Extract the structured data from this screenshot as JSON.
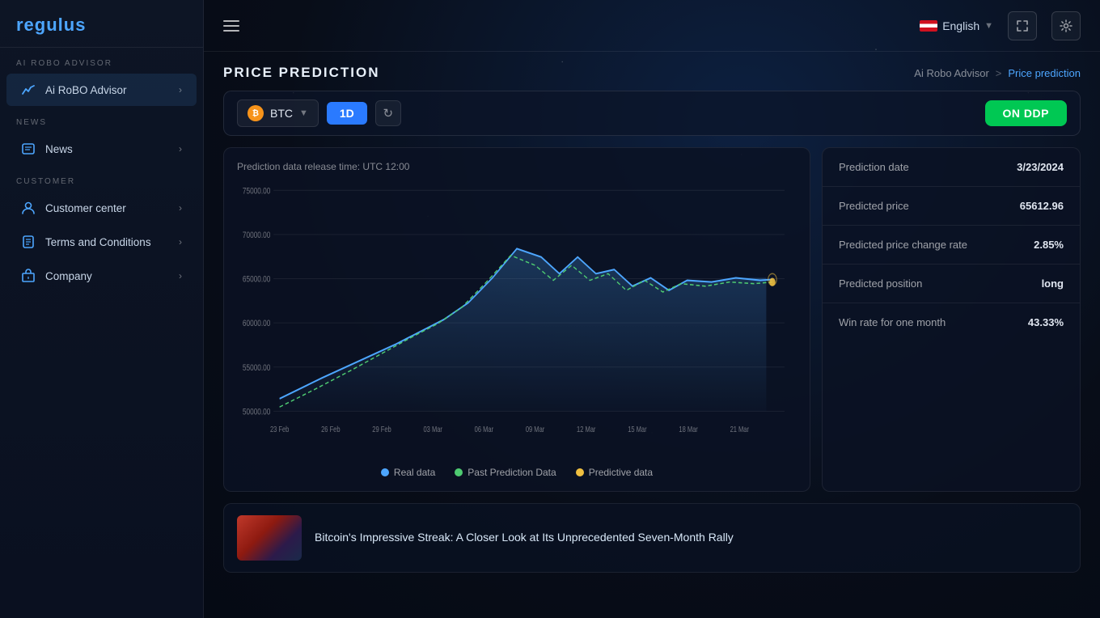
{
  "app": {
    "logo": "regulus",
    "logo_tagline": "regulus"
  },
  "sidebar": {
    "ai_robo_label": "AI ROBO ADVISOR",
    "ai_robo_item": "Ai RoBO Advisor",
    "news_section_label": "NEWS",
    "news_item": "News",
    "customer_section_label": "CUSTOMER",
    "customer_center_item": "Customer center",
    "terms_item": "Terms and Conditions",
    "company_item": "Company"
  },
  "topnav": {
    "language": "English",
    "fullscreen_title": "Fullscreen",
    "settings_title": "Settings"
  },
  "breadcrumb": {
    "parent": "Ai Robo Advisor",
    "separator": ">",
    "current": "Price prediction"
  },
  "page_title": "PRICE PREDICTION",
  "toolbar": {
    "coin": "BTC",
    "period": "1D",
    "ddp_button": "ON DDP",
    "refresh_title": "Refresh"
  },
  "chart": {
    "release_time_label": "Prediction data release time: UTC 12:00",
    "y_axis": [
      "75000.00",
      "70000.00",
      "65000.00",
      "60000.00",
      "55000.00",
      "50000.00"
    ],
    "x_axis": [
      "23 Feb",
      "26 Feb",
      "29 Feb",
      "03 Mar",
      "06 Mar",
      "09 Mar",
      "12 Mar",
      "15 Mar",
      "18 Mar",
      "21 Mar"
    ],
    "legend": [
      {
        "label": "Real data",
        "color": "#4da6ff"
      },
      {
        "label": "Past Prediction Data",
        "color": "#4ecb71"
      },
      {
        "label": "Predictive data",
        "color": "#f0c040"
      }
    ]
  },
  "prediction": {
    "rows": [
      {
        "label": "Prediction date",
        "value": "3/23/2024"
      },
      {
        "label": "Predicted price",
        "value": "65612.96"
      },
      {
        "label": "Predicted price change rate",
        "value": "2.85%"
      },
      {
        "label": "Predicted position",
        "value": "long"
      },
      {
        "label": "Win rate for one month",
        "value": "43.33%"
      }
    ]
  },
  "news": {
    "item_title": "Bitcoin's Impressive Streak: A Closer Look at Its Unprecedented Seven-Month Rally"
  },
  "icons": {
    "hamburger": "☰",
    "chevron_right": "›",
    "refresh": "↻",
    "globe": "🌐",
    "fullscreen": "⛶",
    "settings": "⚙"
  }
}
